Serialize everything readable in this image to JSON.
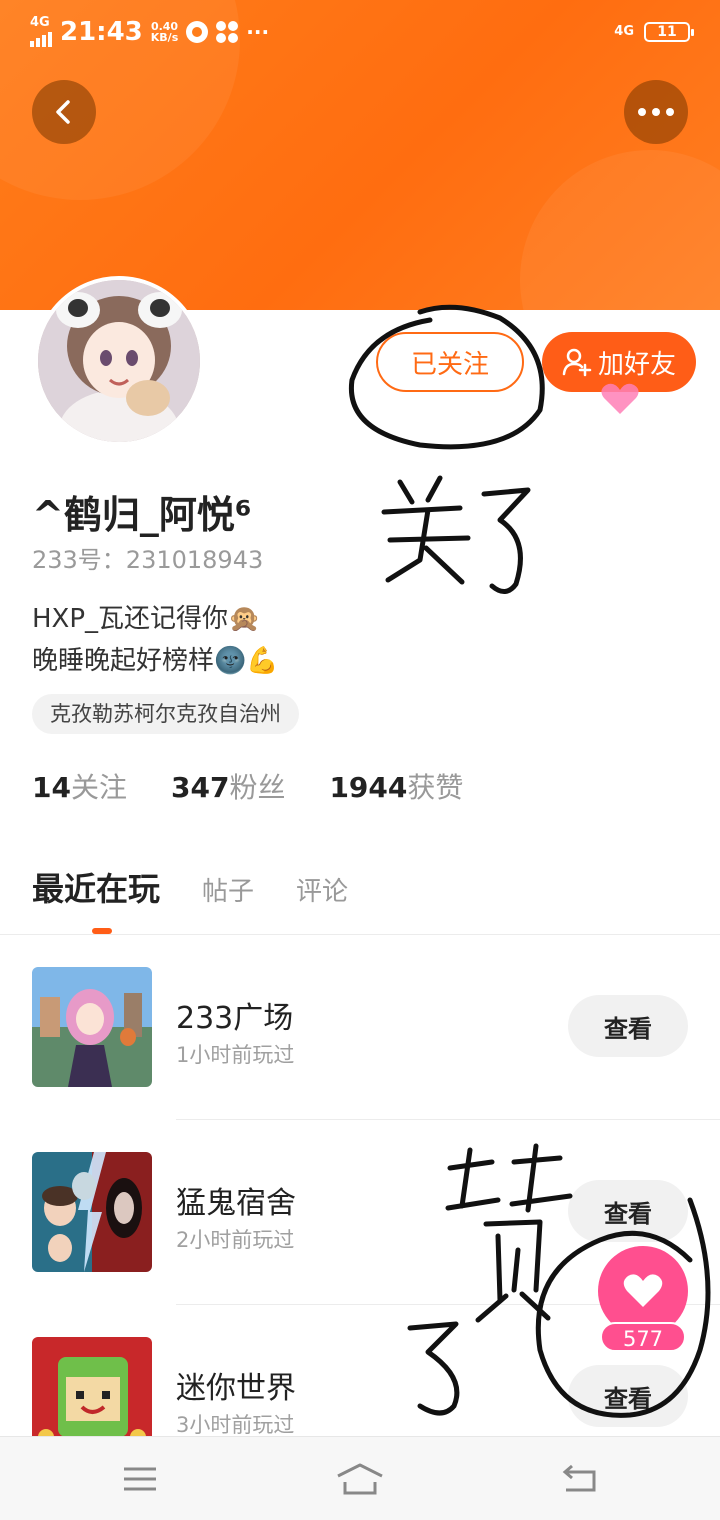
{
  "status_bar": {
    "network": "4G",
    "time": "21:43",
    "speed_value": "0.40",
    "speed_unit": "KB/s",
    "more": "···",
    "right_network": "4G",
    "battery": "11"
  },
  "profile": {
    "follow_status": "已关注",
    "add_friend": "加好友",
    "username": "^鹤归_阿悦⁶",
    "id_text": "233号：231018943",
    "bio_lines": [
      "HXP_瓦还记得你🙊",
      "晚睡晚起好榜样🌚💪"
    ],
    "region": "克孜勒苏柯尔克孜自治州"
  },
  "stats": [
    {
      "value": "14",
      "label": "关注"
    },
    {
      "value": "347",
      "label": "粉丝"
    },
    {
      "value": "1944",
      "label": "获赞"
    }
  ],
  "tabs": [
    {
      "label": "最近在玩",
      "active": true
    },
    {
      "label": "帖子",
      "active": false
    },
    {
      "label": "评论",
      "active": false
    }
  ],
  "games": [
    {
      "name": "233广场",
      "time": "1小时前玩过",
      "action": "查看"
    },
    {
      "name": "猛鬼宿舍",
      "time": "2小时前玩过",
      "action": "查看"
    },
    {
      "name": "迷你世界",
      "time": "3小时前玩过",
      "action": "查看"
    }
  ],
  "like": {
    "count": "577"
  },
  "annotations": {
    "note_top": "关了",
    "note_bottom": "赞了"
  },
  "colors": {
    "banner": "#ff7d1a",
    "accent": "#ff5d17",
    "like": "#ff4f8f"
  },
  "icons": [
    "back-icon",
    "more-icon",
    "add-user-icon",
    "heart-icon",
    "menu-icon",
    "home-icon",
    "return-icon"
  ]
}
